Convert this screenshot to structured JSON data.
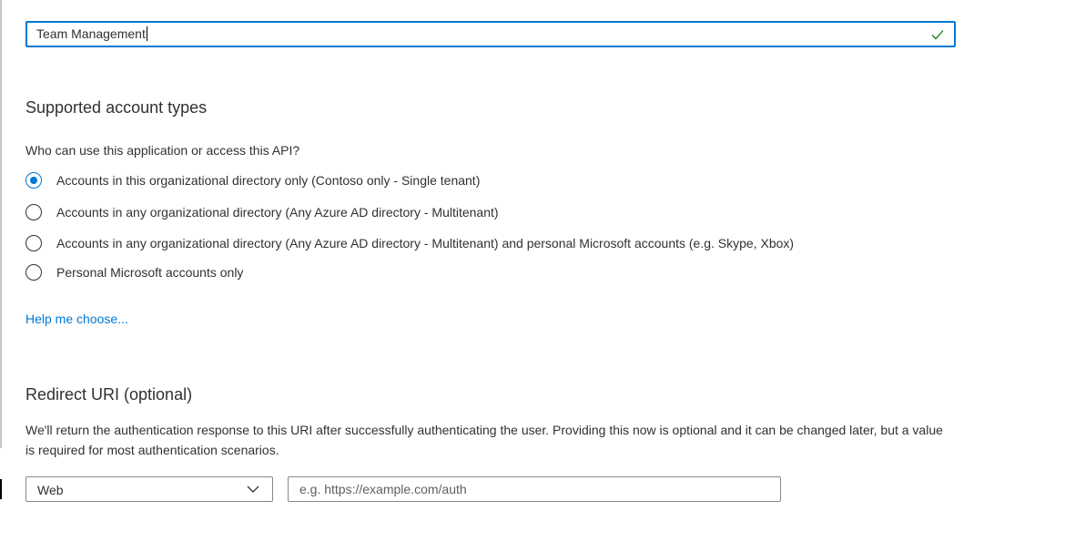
{
  "name_field": {
    "value": "Team Management",
    "status_icon": "checkmark-icon"
  },
  "account_types": {
    "title": "Supported account types",
    "question": "Who can use this application or access this API?",
    "options": [
      {
        "label": "Accounts in this organizational directory only (Contoso only - Single tenant)",
        "checked": true
      },
      {
        "label": "Accounts in any organizational directory (Any Azure AD directory - Multitenant)",
        "checked": false
      },
      {
        "label": "Accounts in any organizational directory (Any Azure AD directory - Multitenant) and personal Microsoft accounts (e.g. Skype, Xbox)",
        "checked": false
      },
      {
        "label": "Personal Microsoft accounts only",
        "checked": false
      }
    ],
    "help_link": "Help me choose..."
  },
  "redirect_uri": {
    "title": "Redirect URI (optional)",
    "description": "We'll return the authentication response to this URI after successfully authenticating the user. Providing this now is optional and it can be changed later, but a value is required for most authentication scenarios.",
    "platform_selected": "Web",
    "uri_placeholder": "e.g. https://example.com/auth",
    "uri_value": ""
  },
  "colors": {
    "accent": "#0078d4",
    "valid_check": "#107c10",
    "text": "#323130",
    "border": "#8a8886"
  }
}
